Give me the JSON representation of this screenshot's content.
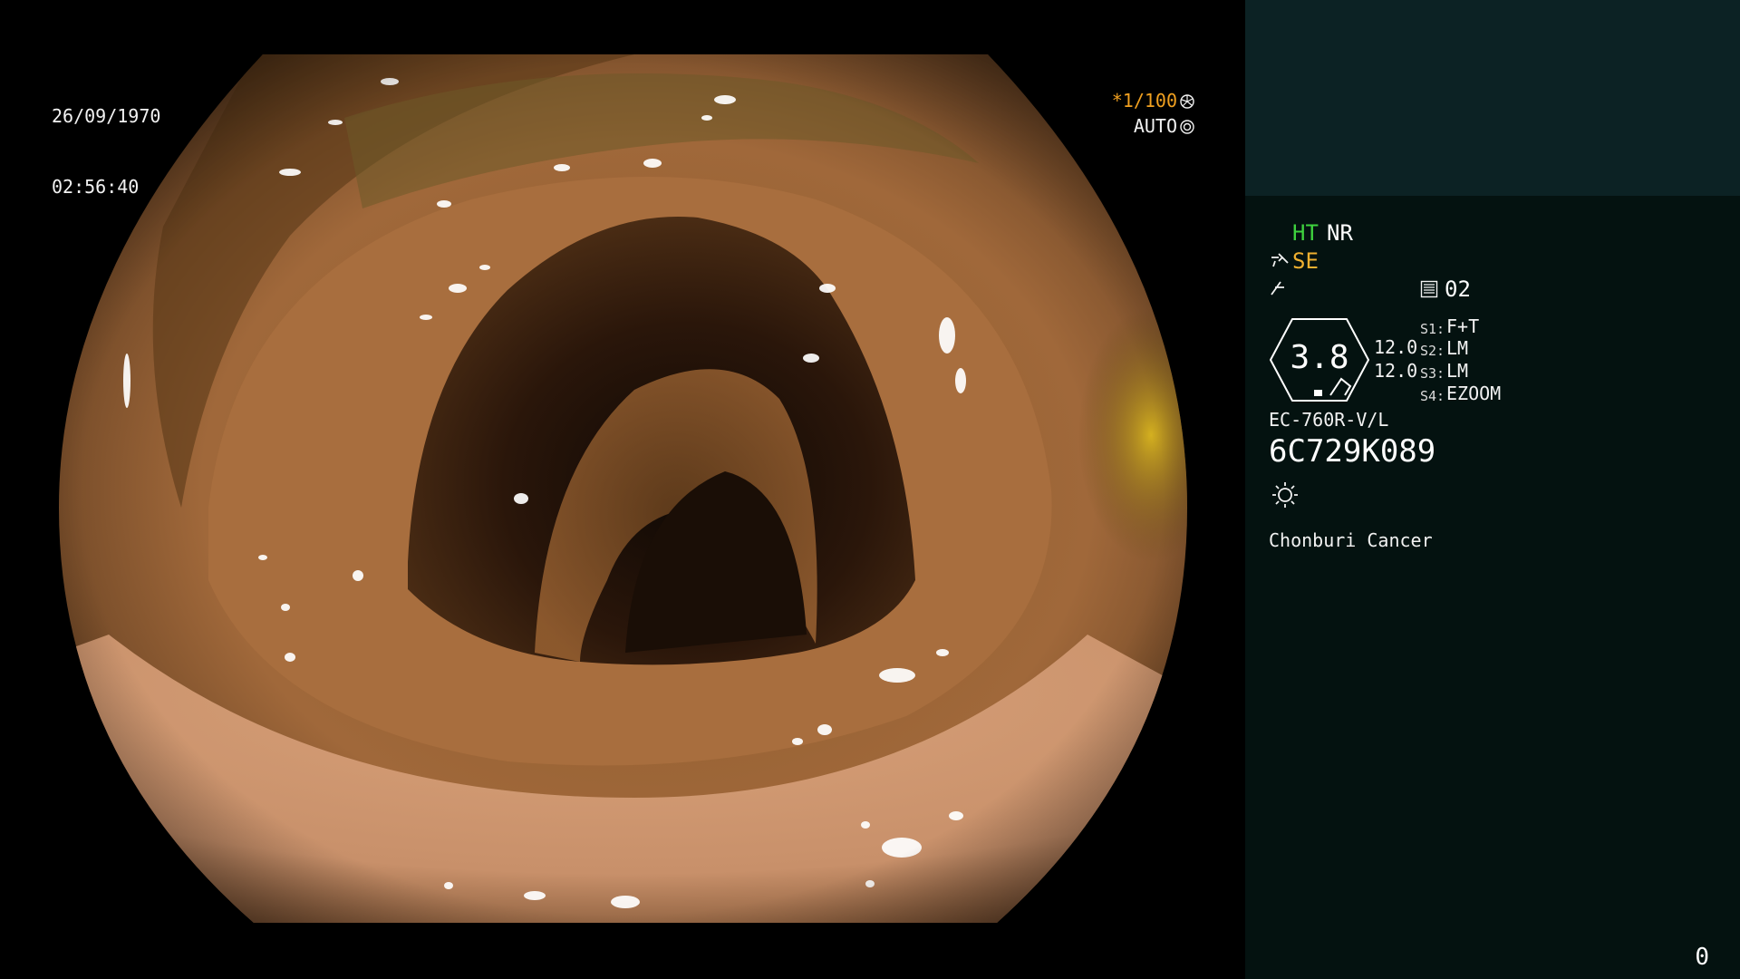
{
  "view": {
    "date": "26/09/1970",
    "time": "02:56:40",
    "shutter": "*1/100",
    "iris_mode": "AUTO"
  },
  "panel": {
    "mode_ht": "HT",
    "mode_nr": "NR",
    "mode_se": "SE",
    "memory_number": "02",
    "magnification": "3.8",
    "level_1": "12.0",
    "level_2": "12.0",
    "switches": [
      {
        "key": "S1:",
        "value": "F+T"
      },
      {
        "key": "S2:",
        "value": "LM"
      },
      {
        "key": "S3:",
        "value": "LM"
      },
      {
        "key": "S4:",
        "value": "EZOOM"
      }
    ],
    "scope_model": "EC-760R-V/L",
    "scope_serial": "6C729K089",
    "hospital": "Chonburi Cancer",
    "counter": "0"
  },
  "colors": {
    "ht_green": "#3ed23e",
    "se_orange": "#f0b030",
    "shutter_orange": "#f0a020",
    "panel_bg": "#041210",
    "panel_top_bg": "#0c2224"
  }
}
